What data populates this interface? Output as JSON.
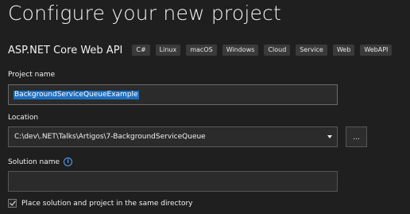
{
  "title": "Configure your new project",
  "template": {
    "name": "ASP.NET Core Web API",
    "tags": [
      "C#",
      "Linux",
      "macOS",
      "Windows",
      "Cloud",
      "Service",
      "Web",
      "WebAPI"
    ]
  },
  "project_name": {
    "label": "Project name",
    "value": "BackgroundServiceQueueExample"
  },
  "location": {
    "label": "Location",
    "value": "C:\\dev\\.NET\\Talks\\Artigos\\7-BackgroundServiceQueue",
    "browse_label": "..."
  },
  "solution_name": {
    "label": "Solution name",
    "value": "",
    "info_icon": "info-icon"
  },
  "same_directory": {
    "label": "Place solution and project in the same directory",
    "checked": true
  },
  "colors": {
    "background": "#1f1f1f",
    "selection": "#1e6fbf",
    "info_accent": "#4aa3ff"
  }
}
